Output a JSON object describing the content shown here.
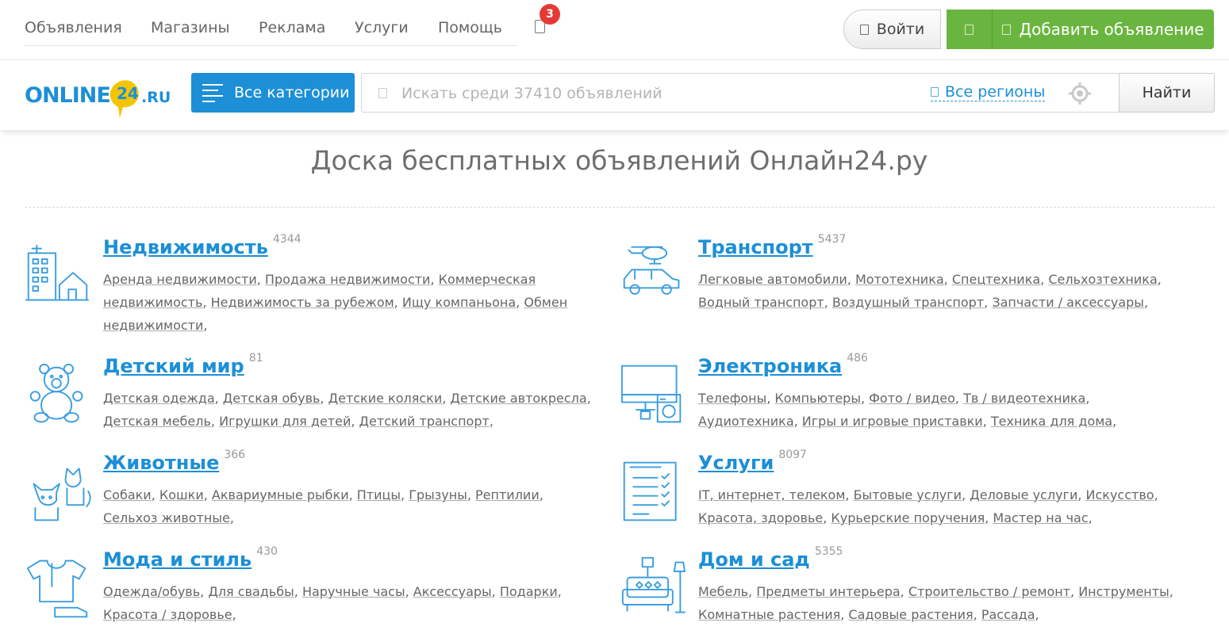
{
  "topnav": {
    "menu": [
      "Объявления",
      "Магазины",
      "Реклама",
      "Услуги",
      "Помощь"
    ],
    "notifications_count": "3",
    "login_label": "Войти",
    "add_label": "Добавить объявление"
  },
  "header": {
    "logo_text_left": "ONLINE",
    "logo_text_num": "24",
    "logo_text_right": ".RU",
    "categories_label": "Все категории",
    "search_placeholder": "Искать среди 37410 объявлений",
    "regions_label": "Все регионы",
    "find_label": "Найти"
  },
  "main": {
    "title": "Доска бесплатных объявлений Онлайн24.ру"
  },
  "categories": [
    {
      "title": "Недвижимость",
      "count": "4344",
      "icon": "building-icon",
      "subs": [
        "Аренда недвижимости",
        "Продажа недвижимости",
        "Коммерческая недвижимость",
        "Недвижимость за рубежом",
        "Ищу компаньона",
        "Обмен недвижимости"
      ]
    },
    {
      "title": "Транспорт",
      "count": "5437",
      "icon": "car-helicopter-icon",
      "subs": [
        "Легковые автомобили",
        "Мототехника",
        "Спецтехника",
        "Сельхозтехника",
        "Водный транспорт",
        "Воздушный транспорт",
        "Запчасти / аксессуары"
      ]
    },
    {
      "title": "Детский мир",
      "count": "81",
      "icon": "teddy-bear-icon",
      "subs": [
        "Детская одежда",
        "Детская обувь",
        "Детские коляски",
        "Детские автокресла",
        "Детская мебель",
        "Игрушки для детей",
        "Детский транспорт"
      ]
    },
    {
      "title": "Электроника",
      "count": "486",
      "icon": "electronics-icon",
      "subs": [
        "Телефоны",
        "Компьютеры",
        "Фото / видео",
        "Тв / видеотехника",
        "Аудиотехника",
        "Игры и игровые приставки",
        "Техника для дома"
      ]
    },
    {
      "title": "Животные",
      "count": "366",
      "icon": "cat-dog-icon",
      "subs": [
        "Собаки",
        "Кошки",
        "Аквариумные рыбки",
        "Птицы",
        "Грызуны",
        "Рептилии",
        "Сельхоз животные"
      ]
    },
    {
      "title": "Услуги",
      "count": "8097",
      "icon": "checklist-icon",
      "subs": [
        "IT, интернет, телеком",
        "Бытовые услуги",
        "Деловые услуги",
        "Искусство",
        "Красота, здоровье",
        "Курьерские поручения",
        "Мастер на час"
      ]
    },
    {
      "title": "Мода и стиль",
      "count": "430",
      "icon": "tshirt-shoe-icon",
      "subs": [
        "Одежда/обувь",
        "Для свадьбы",
        "Наручные часы",
        "Аксессуары",
        "Подарки",
        "Красота / здоровье"
      ]
    },
    {
      "title": "Дом и сад",
      "count": "5355",
      "icon": "sofa-lamp-icon",
      "subs": [
        "Мебель",
        "Предметы интерьера",
        "Строительство / ремонт",
        "Инструменты",
        "Комнатные растения",
        "Садовые растения",
        "Рассада"
      ]
    }
  ],
  "colors": {
    "accent": "#1c8fd6",
    "green": "#6ab53f",
    "badge": "#e53935"
  }
}
